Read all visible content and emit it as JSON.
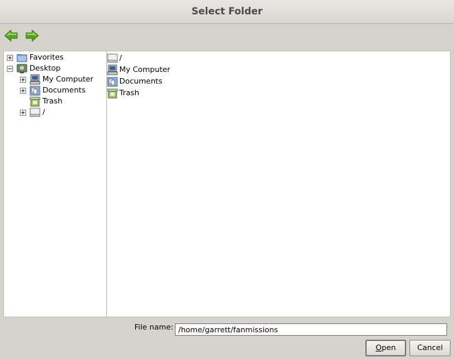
{
  "window": {
    "title": "Select Folder"
  },
  "toolbar": {
    "back_icon": "back-arrow-icon",
    "forward_icon": "forward-arrow-icon",
    "arrow_color": "#5aa31f"
  },
  "tree": {
    "items": [
      {
        "label": "Favorites",
        "icon": "folder-favorites-icon",
        "expander": "plus"
      },
      {
        "label": "Desktop",
        "icon": "desktop-icon",
        "expander": "minus"
      },
      {
        "label": "My Computer",
        "icon": "computer-icon",
        "expander": "plus"
      },
      {
        "label": "Documents",
        "icon": "documents-folder-icon",
        "expander": "plus"
      },
      {
        "label": "Trash",
        "icon": "trash-icon",
        "expander": "none"
      },
      {
        "label": "/",
        "icon": "drive-icon",
        "expander": "plus"
      }
    ]
  },
  "list": {
    "items": [
      {
        "label": "/",
        "icon": "drive-icon"
      },
      {
        "label": "My Computer",
        "icon": "computer-icon"
      },
      {
        "label": "Documents",
        "icon": "documents-folder-icon"
      },
      {
        "label": "Trash",
        "icon": "trash-icon"
      }
    ]
  },
  "footer": {
    "filename_label": "File name:",
    "filename_value": "/home/garrett/fanmissions",
    "open_label_mnemonic": "O",
    "open_label_rest": "pen",
    "cancel_label": "Cancel"
  }
}
